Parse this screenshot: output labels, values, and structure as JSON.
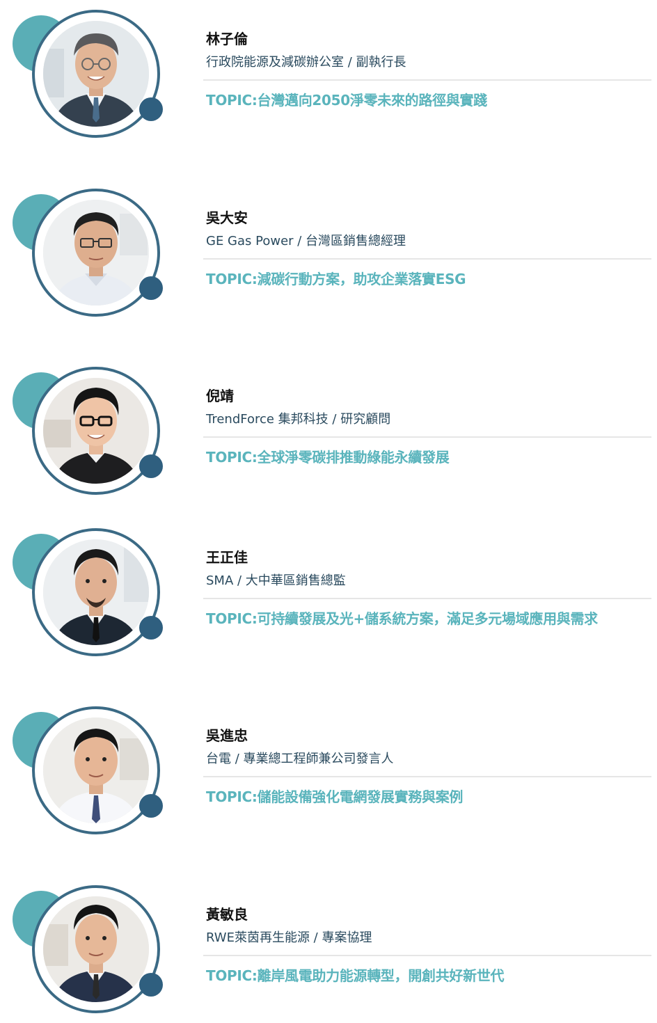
{
  "speakers": [
    {
      "name": "林子倫",
      "title": "行政院能源及減碳辦公室 / 副執行長",
      "topic": "TOPIC:台灣邁向2050淨零未來的路徑與實踐"
    },
    {
      "name": "吳大安",
      "title": "GE Gas Power / 台灣區銷售總經理",
      "topic": "TOPIC:減碳行動方案，助攻企業落實ESG"
    },
    {
      "name": "倪靖",
      "title": "TrendForce 集邦科技 / 研究顧問",
      "topic": "TOPIC:全球淨零碳排推動綠能永續發展"
    },
    {
      "name": "王正佳",
      "title": "SMA / 大中華區銷售總監",
      "topic": "TOPIC:可持續發展及光+儲系統方案，滿足多元場域應用與需求"
    },
    {
      "name": "吳進忠",
      "title": "台電 / 專業總工程師兼公司發言人",
      "topic": "TOPIC:儲能設備強化電網發展實務與案例"
    },
    {
      "name": "黃敏良",
      "title": "RWE萊茵再生能源 / 專案協理",
      "topic": "TOPIC:離岸風電助力能源轉型，開創共好新世代"
    }
  ],
  "colors": {
    "accent_teal": "#5ab4bc",
    "ring_blue": "#3b6a85",
    "dot_blue": "#2f5f7f"
  }
}
